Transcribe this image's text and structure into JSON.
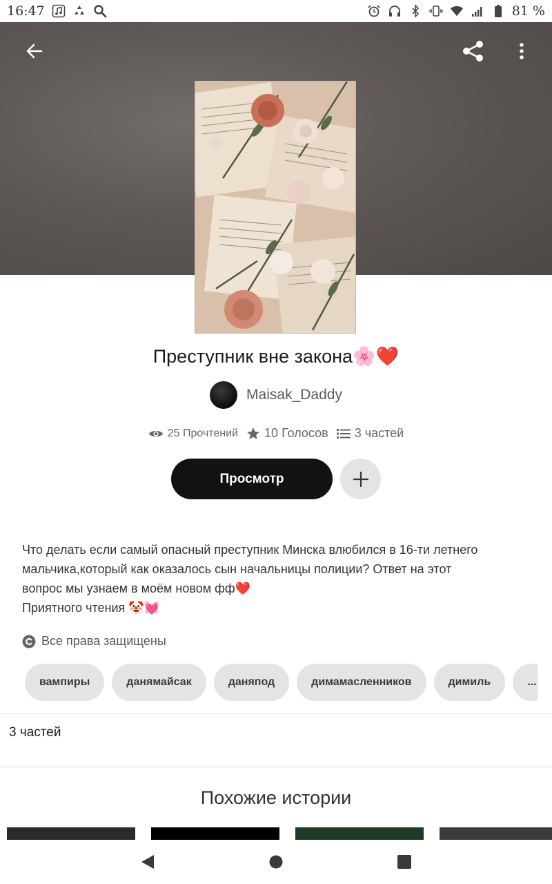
{
  "status_bar": {
    "time": "16:47",
    "battery": "81 %",
    "left_icons": [
      "music-icon",
      "recycle-icon",
      "search-icon"
    ],
    "right_icons": [
      "alarm-icon",
      "headphones-icon",
      "bluetooth-icon",
      "vibrate-icon",
      "wifi-icon",
      "signal-icon",
      "battery-icon"
    ]
  },
  "toolbar": {
    "back_icon": "arrow-left-icon",
    "share_icon": "share-icon",
    "more_icon": "more-vertical-icon"
  },
  "story": {
    "title": "Преступник вне закона🌸❤️",
    "author": "Maisak_Daddy",
    "reads": "25 Прочтений",
    "votes": "10 Голосов",
    "parts": "3 частей"
  },
  "actions": {
    "read_label": "Просмотр",
    "add_icon": "plus-icon"
  },
  "description": {
    "lines": [
      "Что делать если самый опасный преступник  Минска влюбился в 16-ти летнего",
      "мальчика,который как оказалось сын начальницы полиции? Ответ на этот",
      "вопрос мы узнаем в моём новом фф❤️",
      "Приятного чтения 🤡💓"
    ]
  },
  "copyright": {
    "label": "Все права защищены"
  },
  "tags": [
    "вампиры",
    "данямайсак",
    "даняпод",
    "димамасленников",
    "димиль",
    "..."
  ],
  "parts_section": {
    "label": "3 частей"
  },
  "similar": {
    "title": "Похожие истории"
  },
  "colors": {
    "primary_button": "#121212",
    "secondary_button": "#e4e4e4",
    "hero_background": "#5d5856",
    "muted_text": "#666666"
  }
}
